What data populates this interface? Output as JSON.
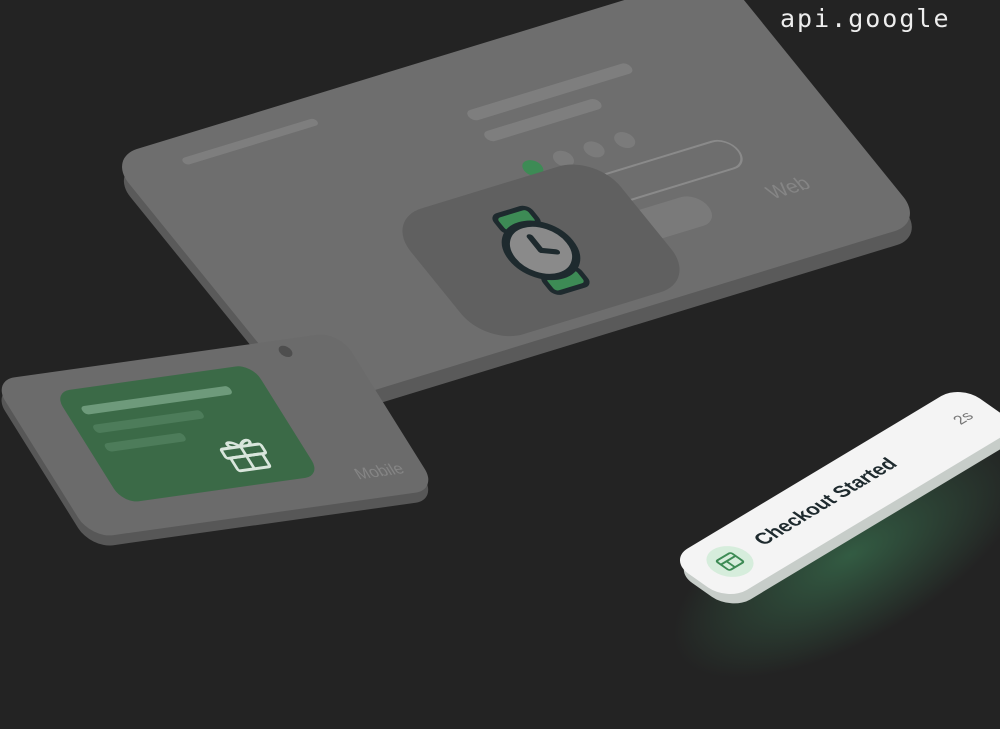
{
  "url_fragment": "api.google",
  "web_card": {
    "caption": "Web",
    "icon": "watch-icon"
  },
  "mobile_card": {
    "caption": "Mobile",
    "icon": "gift-icon"
  },
  "event": {
    "label": "Checkout Started",
    "time": "2s",
    "icon": "layout-icon"
  },
  "colors": {
    "background": "#232323",
    "card": "#6e6e6e",
    "accent_green": "#3d8b55",
    "event_pill": "#f4f4f4"
  }
}
